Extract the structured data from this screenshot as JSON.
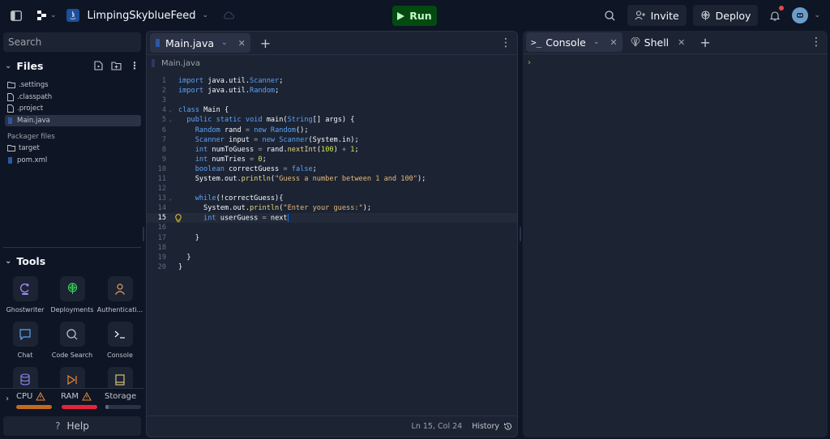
{
  "topbar": {
    "repl_name": "LimpingSkyblueFeed",
    "run_label": "Run",
    "invite_label": "Invite",
    "deploy_label": "Deploy",
    "notification_dot_color": "#e5484d",
    "run_bg_color": "#044a10"
  },
  "sidebar": {
    "search_placeholder": "Search",
    "files_title": "Files",
    "files": [
      {
        "name": ".settings",
        "icon": "folder-icon"
      },
      {
        "name": ".classpath",
        "icon": "file-icon"
      },
      {
        "name": ".project",
        "icon": "file-icon"
      },
      {
        "name": "Main.java",
        "icon": "java-icon",
        "active": true
      }
    ],
    "packager_label": "Packager files",
    "packager_files": [
      {
        "name": "target",
        "icon": "folder-icon"
      },
      {
        "name": "pom.xml",
        "icon": "java-icon"
      }
    ],
    "tools_title": "Tools",
    "tools": [
      {
        "label": "Ghostwriter",
        "icon": "ghostwriter-icon"
      },
      {
        "label": "Deployments",
        "icon": "deployments-icon"
      },
      {
        "label": "Authenticati...",
        "icon": "authentication-icon"
      },
      {
        "label": "Chat",
        "icon": "chat-icon"
      },
      {
        "label": "Code Search",
        "icon": "code-search-icon"
      },
      {
        "label": "Console",
        "icon": "console-icon"
      },
      {
        "label": "Database",
        "icon": "database-icon"
      },
      {
        "label": "Debugger",
        "icon": "debugger-icon"
      },
      {
        "label": "Docs",
        "icon": "docs-icon"
      }
    ],
    "resources": {
      "cpu_label": "CPU",
      "ram_label": "RAM",
      "storage_label": "Storage",
      "cpu_usage": 1.0,
      "ram_usage": 1.0,
      "storage_usage": 0.1,
      "cpu_color": "#c46a1f",
      "ram_color": "#e5243b"
    },
    "help_label": "Help"
  },
  "editor": {
    "tab_label": "Main.java",
    "breadcrumb": "Main.java",
    "cursor_line": 15,
    "lines": [
      "import java.util.Scanner;",
      "import java.util.Random;",
      "",
      "class Main {",
      "  public static void main(String[] args) {",
      "    Random rand = new Random();",
      "    Scanner input = new Scanner(System.in);",
      "    int numToGuess = rand.nextInt(100) + 1;",
      "    int numTries = 0;",
      "    boolean correctGuess = false;",
      "    System.out.println(\"Guess a number between 1 and 100\");",
      "",
      "    while(!correctGuess){",
      "      System.out.println(\"Enter your guess:\");",
      "      int userGuess = next",
      "",
      "    }",
      "",
      "  }",
      "}"
    ],
    "foldable_lines": [
      4,
      5,
      13
    ],
    "status_position": "Ln 15, Col 24",
    "history_label": "History"
  },
  "console_panel": {
    "tab_console": "Console",
    "tab_shell": "Shell",
    "prompt": "›"
  }
}
